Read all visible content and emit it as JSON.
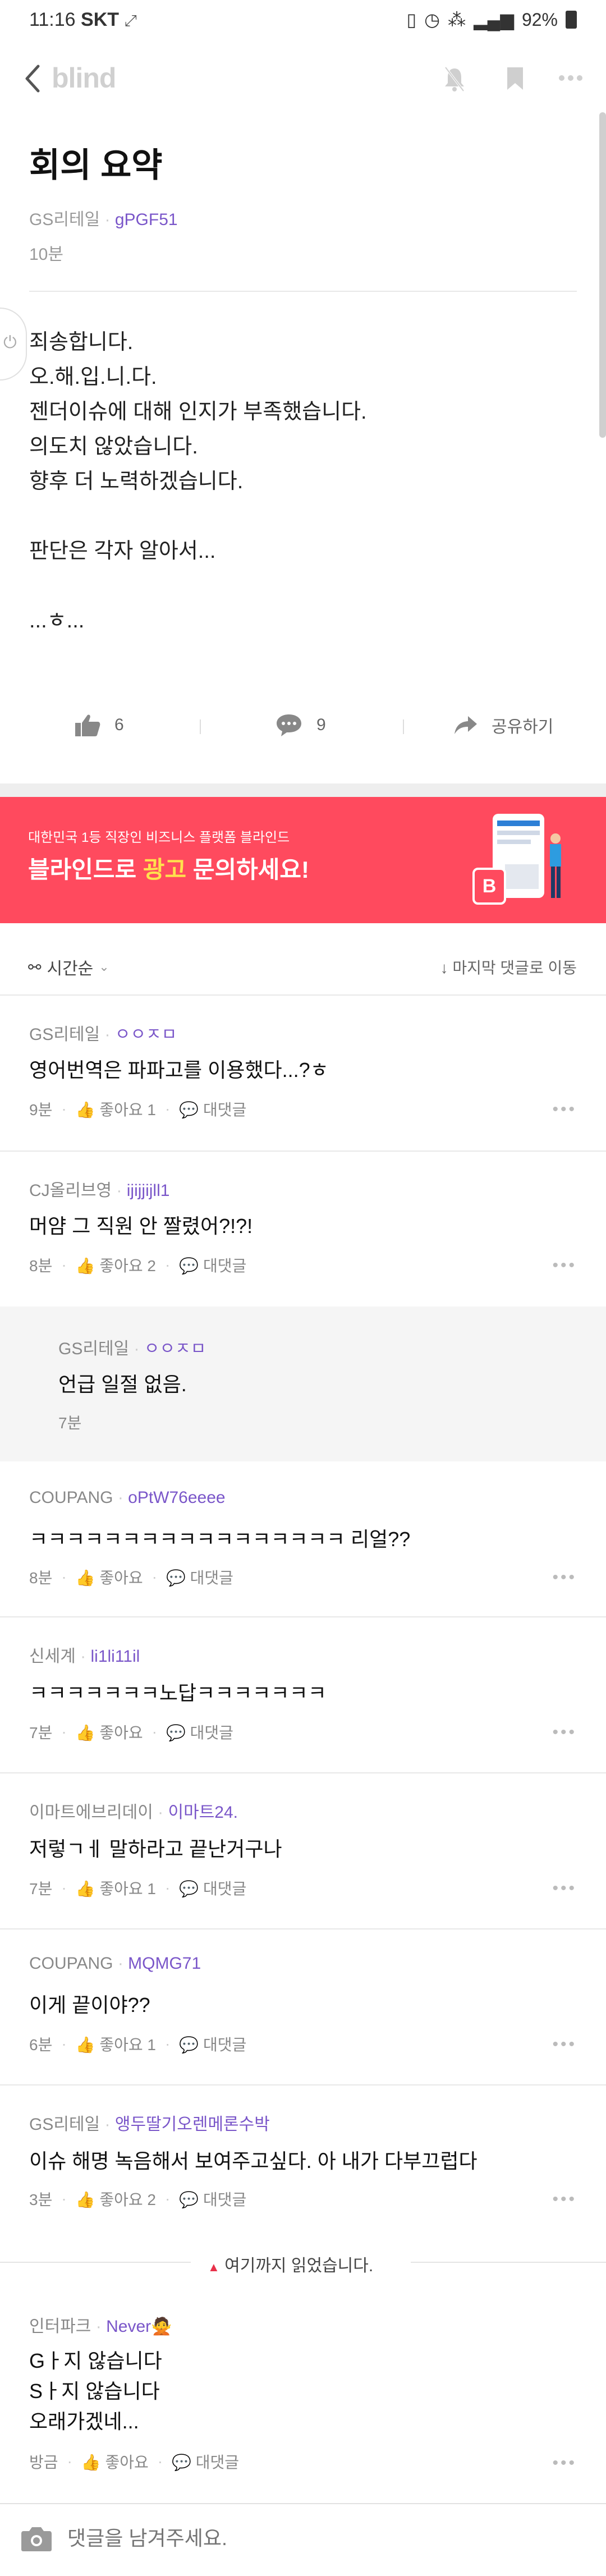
{
  "status": {
    "time": "11:16",
    "carrier": "SKT",
    "battery": "92%"
  },
  "nav": {
    "brand": "blind"
  },
  "post": {
    "title": "회의 요약",
    "company": "GS리테일",
    "nickname": "gPGF51",
    "time": "10분",
    "body": [
      "죄송합니다.",
      "오.해.입.니.다.",
      "젠더이슈에 대해 인지가 부족했습니다.",
      "의도치 않았습니다.",
      "향후 더 노력하겠습니다.",
      "",
      "판단은 각자 알아서...",
      "",
      "...ㅎ..."
    ],
    "likes": "6",
    "comments": "9",
    "share_label": "공유하기"
  },
  "banner": {
    "top_text": "대한민국 1등 직장인 비즈니스 플랫폼 블라인드",
    "main_pre": "블라인드로 ",
    "main_highlight": "광고",
    "main_post": " 문의하세요!",
    "highlight_color": "#ffe14d",
    "bg_color": "#ff4a5e"
  },
  "sort": {
    "order_label": "시간순",
    "jump_label": "마지막 댓글로 이동"
  },
  "comments": [
    {
      "company": "GS리테일",
      "nickname": "ㅇㅇㅈㅁ",
      "text": "영어번역은 파파고를 이용했다...?ㅎ",
      "time": "9분",
      "like_label": "좋아요 1",
      "reply_label": "대댓글"
    },
    {
      "company": "CJ올리브영",
      "nickname": "ijijjijll1",
      "text": "머얌 그 직원 안 짤렸어?!?!",
      "time": "8분",
      "like_label": "좋아요 2",
      "reply_label": "대댓글"
    },
    {
      "company": "GS리테일",
      "nickname": "ㅇㅇㅈㅁ",
      "text": "언급 일절 없음.",
      "time": "7분"
    },
    {
      "company": "COUPANG",
      "nickname": "oPtW76eeee",
      "text": "ㅋㅋㅋㅋㅋㅋㅋㅋㅋㅋㅋㅋㅋㅋㅋㅋㅋ 리얼??",
      "time": "8분",
      "like_label": "좋아요",
      "reply_label": "대댓글"
    },
    {
      "company": "신세계",
      "nickname": "li1li11il",
      "text": "ㅋㅋㅋㅋㅋㅋㅋ노답ㅋㅋㅋㅋㅋㅋㅋ",
      "time": "7분",
      "like_label": "좋아요",
      "reply_label": "대댓글"
    },
    {
      "company": "이마트에브리데이",
      "nickname": "이마트24.",
      "text": "저렇ㄱㅔ 말하라고 끝난거구나",
      "time": "7분",
      "like_label": "좋아요 1",
      "reply_label": "대댓글"
    },
    {
      "company": "COUPANG",
      "nickname": "MQMG71",
      "text": "이게 끝이야??",
      "time": "6분",
      "like_label": "좋아요 1",
      "reply_label": "대댓글"
    },
    {
      "company": "GS리테일",
      "nickname": "앵두딸기오렌메론수박",
      "text": "이슈 해명 녹음해서 보여주고싶다. 아 내가 다부끄럽다",
      "time": "3분",
      "like_label": "좋아요 2",
      "reply_label": "대댓글"
    },
    {
      "company": "인터파크",
      "nickname": "Never🙅",
      "text_lines": [
        "Gㅏ지 않습니다",
        "Sㅏ지 않습니다",
        "오래가겠네..."
      ],
      "time": "방금",
      "like_label": "좋아요",
      "reply_label": "대댓글"
    }
  ],
  "read_marker": "여기까지 읽었습니다.",
  "input": {
    "placeholder": "댓글을 남겨주세요."
  },
  "colors": {
    "nickname": "#7a56c9",
    "read_marker_arrow": "#e8314a"
  }
}
